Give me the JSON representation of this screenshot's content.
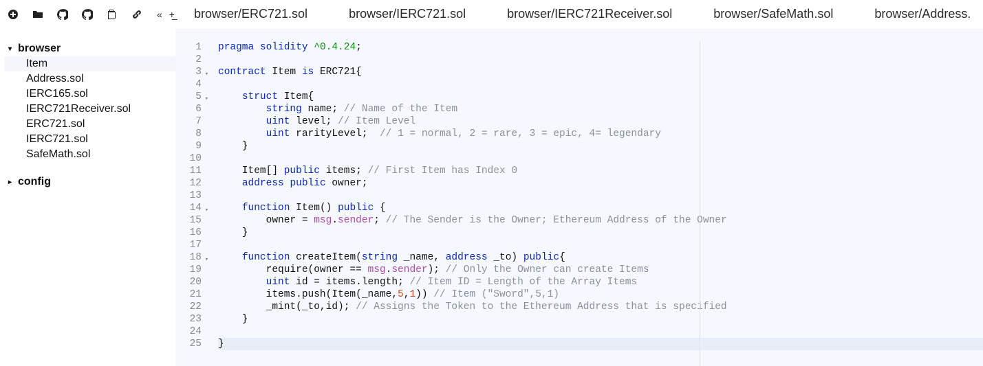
{
  "tabs": {
    "items": [
      {
        "label": "browser/ERC721.sol"
      },
      {
        "label": "browser/IERC721.sol"
      },
      {
        "label": "browser/IERC721Receiver.sol"
      },
      {
        "label": "browser/SafeMath.sol"
      },
      {
        "label": "browser/Address."
      }
    ],
    "back": "«",
    "add": "+̲",
    "more": "»"
  },
  "tree": {
    "folders": [
      {
        "name": "browser",
        "expanded": true,
        "caret": "▾",
        "files": [
          {
            "name": "Item",
            "selected": true
          },
          {
            "name": "Address.sol"
          },
          {
            "name": "IERC165.sol"
          },
          {
            "name": "IERC721Receiver.sol"
          },
          {
            "name": "ERC721.sol"
          },
          {
            "name": "IERC721.sol"
          },
          {
            "name": "SafeMath.sol"
          }
        ]
      },
      {
        "name": "config",
        "expanded": false,
        "caret": "▸",
        "files": []
      }
    ]
  },
  "code": {
    "foldable": [
      3,
      5,
      14,
      18
    ],
    "lines": [
      {
        "n": 1,
        "seg": [
          [
            "kw",
            "pragma"
          ],
          [
            "nm",
            " "
          ],
          [
            "kw",
            "solidity"
          ],
          [
            "nm",
            " "
          ],
          [
            "ver",
            "^0.4.24"
          ],
          [
            "nm",
            ";"
          ]
        ]
      },
      {
        "n": 2,
        "seg": []
      },
      {
        "n": 3,
        "seg": [
          [
            "kw",
            "contract"
          ],
          [
            "nm",
            " Item "
          ],
          [
            "kw",
            "is"
          ],
          [
            "nm",
            " ERC721{"
          ]
        ]
      },
      {
        "n": 4,
        "seg": []
      },
      {
        "n": 5,
        "seg": [
          [
            "nm",
            "    "
          ],
          [
            "kw",
            "struct"
          ],
          [
            "nm",
            " Item{"
          ]
        ]
      },
      {
        "n": 6,
        "seg": [
          [
            "nm",
            "        "
          ],
          [
            "kw",
            "string"
          ],
          [
            "nm",
            " name; "
          ],
          [
            "cmt",
            "// Name of the Item"
          ]
        ]
      },
      {
        "n": 7,
        "seg": [
          [
            "nm",
            "        "
          ],
          [
            "kw",
            "uint"
          ],
          [
            "nm",
            " level; "
          ],
          [
            "cmt",
            "// Item Level"
          ]
        ]
      },
      {
        "n": 8,
        "seg": [
          [
            "nm",
            "        "
          ],
          [
            "kw",
            "uint"
          ],
          [
            "nm",
            " rarityLevel;  "
          ],
          [
            "cmt",
            "// 1 = normal, 2 = rare, 3 = epic, 4= legendary"
          ]
        ]
      },
      {
        "n": 9,
        "seg": [
          [
            "nm",
            "    }"
          ]
        ]
      },
      {
        "n": 10,
        "seg": []
      },
      {
        "n": 11,
        "seg": [
          [
            "nm",
            "    Item[] "
          ],
          [
            "kw",
            "public"
          ],
          [
            "nm",
            " items; "
          ],
          [
            "cmt",
            "// First Item has Index 0"
          ]
        ]
      },
      {
        "n": 12,
        "seg": [
          [
            "nm",
            "    "
          ],
          [
            "kw",
            "address"
          ],
          [
            "nm",
            " "
          ],
          [
            "kw",
            "public"
          ],
          [
            "nm",
            " owner;"
          ]
        ]
      },
      {
        "n": 13,
        "seg": []
      },
      {
        "n": 14,
        "seg": [
          [
            "nm",
            "    "
          ],
          [
            "kw",
            "function"
          ],
          [
            "nm",
            " Item() "
          ],
          [
            "kw",
            "public"
          ],
          [
            "nm",
            " {"
          ]
        ]
      },
      {
        "n": 15,
        "seg": [
          [
            "nm",
            "        owner = "
          ],
          [
            "op",
            "msg"
          ],
          [
            "nm",
            "."
          ],
          [
            "op",
            "sender"
          ],
          [
            "nm",
            "; "
          ],
          [
            "cmt",
            "// The Sender is the Owner; Ethereum Address of the Owner"
          ]
        ]
      },
      {
        "n": 16,
        "seg": [
          [
            "nm",
            "    }"
          ]
        ]
      },
      {
        "n": 17,
        "seg": []
      },
      {
        "n": 18,
        "seg": [
          [
            "nm",
            "    "
          ],
          [
            "kw",
            "function"
          ],
          [
            "nm",
            " createItem("
          ],
          [
            "kw",
            "string"
          ],
          [
            "nm",
            " _name, "
          ],
          [
            "kw",
            "address"
          ],
          [
            "nm",
            " _to) "
          ],
          [
            "kw",
            "public"
          ],
          [
            "nm",
            "{"
          ]
        ]
      },
      {
        "n": 19,
        "seg": [
          [
            "nm",
            "        require(owner == "
          ],
          [
            "op",
            "msg"
          ],
          [
            "nm",
            "."
          ],
          [
            "op",
            "sender"
          ],
          [
            "nm",
            "); "
          ],
          [
            "cmt",
            "// Only the Owner can create Items"
          ]
        ]
      },
      {
        "n": 20,
        "seg": [
          [
            "nm",
            "        "
          ],
          [
            "kw",
            "uint"
          ],
          [
            "nm",
            " id = items.length; "
          ],
          [
            "cmt",
            "// Item ID = Length of the Array Items"
          ]
        ]
      },
      {
        "n": 21,
        "seg": [
          [
            "nm",
            "        items.push(Item(_name,"
          ],
          [
            "num",
            "5"
          ],
          [
            "nm",
            ","
          ],
          [
            "num",
            "1"
          ],
          [
            "nm",
            ")) "
          ],
          [
            "cmt",
            "// Item (\"Sword\",5,1)"
          ]
        ]
      },
      {
        "n": 22,
        "seg": [
          [
            "nm",
            "        _mint(_to,id); "
          ],
          [
            "cmt",
            "// Assigns the Token to the Ethereum Address that is specified"
          ]
        ]
      },
      {
        "n": 23,
        "seg": [
          [
            "nm",
            "    }"
          ]
        ]
      },
      {
        "n": 24,
        "seg": []
      },
      {
        "n": 25,
        "seg": [
          [
            "nm",
            "}"
          ]
        ],
        "cursor": true
      }
    ]
  }
}
